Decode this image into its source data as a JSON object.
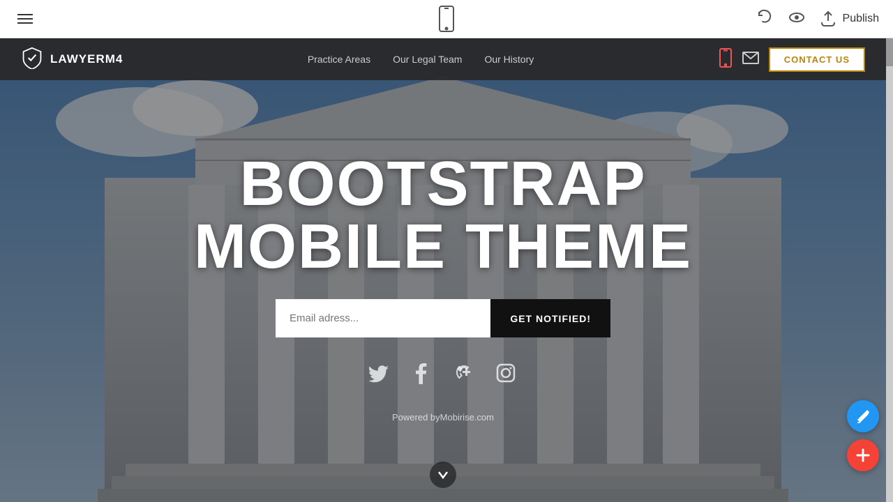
{
  "editor": {
    "publish_label": "Publish",
    "undo_title": "Undo",
    "preview_title": "Preview"
  },
  "navbar": {
    "brand": "LAWYERM4",
    "nav_items": [
      {
        "label": "Practice Areas"
      },
      {
        "label": "Our Legal Team"
      },
      {
        "label": "Our History"
      }
    ],
    "contact_label": "CONTACT US"
  },
  "hero": {
    "title_line1": "BOOTSTRAP",
    "title_line2": "MOBILE THEME",
    "email_placeholder": "Email adress...",
    "cta_label": "GET NOTIFIED!",
    "powered_text": "Powered by",
    "powered_link": "Mobirise.com"
  },
  "social": {
    "icons": [
      "twitter",
      "facebook",
      "google-plus",
      "instagram"
    ]
  }
}
